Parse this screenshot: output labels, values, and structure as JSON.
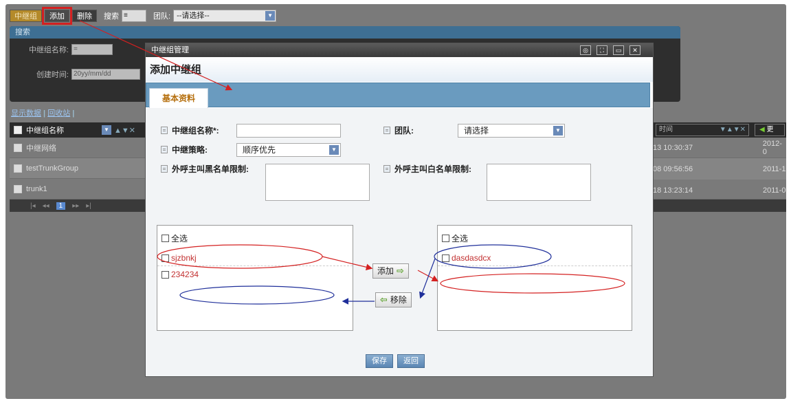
{
  "toolbar": {
    "first_btn": "中继组",
    "add_btn": "添加",
    "delete_btn": "删除",
    "search_label": "搜索",
    "op_select": "≡",
    "team_label": "团队:",
    "team_select": "--请选择--"
  },
  "search": {
    "header": "搜索",
    "name_label": "中继组名称:",
    "name_op": "=",
    "created_label": "创建时间:",
    "created_value": "20yy/mm/dd"
  },
  "links": {
    "show_data": "显示数据",
    "sep": " | ",
    "recycle": "回收站",
    "end": " |"
  },
  "grid": {
    "header_col": "中继组名称",
    "rows": [
      {
        "name": "中继网络",
        "time": "13 10:30:37",
        "extra": "2012-0"
      },
      {
        "name": "testTrunkGroup",
        "time": "08 09:56:56",
        "extra": "2011-1"
      },
      {
        "name": "trunk1",
        "time": "18 13:23:14",
        "extra": "2011-0"
      }
    ],
    "right_header_col": "时间",
    "right_btn": "更",
    "pager": {
      "first": "|◂",
      "prev": "◂◂",
      "page": "1",
      "next": "▸▸",
      "last": "▸|"
    }
  },
  "modal": {
    "window_title": "中继组管理",
    "header": "添加中继组",
    "tab": "基本资料",
    "fields": {
      "name_label": "中继组名称*:",
      "team_label": "团队:",
      "team_value": "请选择",
      "strategy_label": "中继策略:",
      "strategy_value": "顺序优先",
      "blacklist_label": "外呼主叫黑名单限制:",
      "whitelist_label": "外呼主叫白名单限制:"
    },
    "left_list": {
      "select_all": "全选",
      "items": [
        "sjzbnkj",
        "234234"
      ]
    },
    "right_list": {
      "select_all": "全选",
      "items": [
        "dasdasdcx"
      ]
    },
    "add_btn": "添加",
    "remove_btn": "移除",
    "save_btn": "保存",
    "back_btn": "返回"
  },
  "colors": {
    "highlight_red": "#d42020",
    "annotation_blue": "#1f2f9a",
    "tab_blue": "#6a9bbf"
  }
}
